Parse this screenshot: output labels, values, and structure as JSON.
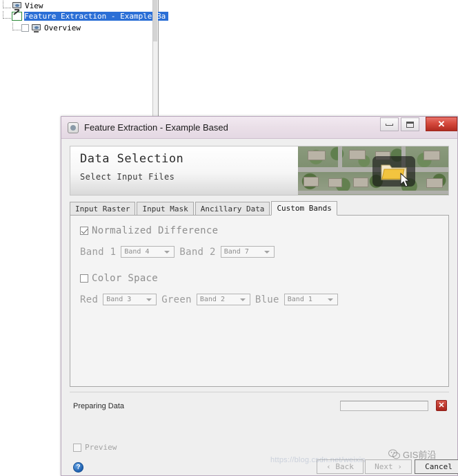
{
  "tree": {
    "items": [
      {
        "label": "View",
        "icon": "monitor-icon",
        "selected": false
      },
      {
        "label": "Feature Extraction - Example Ba",
        "icon": "pencil-icon",
        "selected": true
      },
      {
        "label": "Overview",
        "icon": "monitor-icon",
        "selected": false
      }
    ]
  },
  "dialog": {
    "title": "Feature Extraction - Example Based",
    "window_controls": {
      "minimize": "–",
      "maximize": "□",
      "close": "✕"
    },
    "banner": {
      "title": "Data Selection",
      "subtitle": "Select Input Files",
      "icon": "folder-icon",
      "cursor": "arrow-cursor"
    },
    "tabs": [
      {
        "label": "Input Raster",
        "active": false
      },
      {
        "label": "Input Mask",
        "active": false
      },
      {
        "label": "Ancillary Data",
        "active": false
      },
      {
        "label": "Custom Bands",
        "active": true
      }
    ],
    "normalized_difference": {
      "label": "Normalized Difference",
      "checked": true,
      "fields": [
        {
          "label": "Band 1",
          "value": "Band 4"
        },
        {
          "label": "Band 2",
          "value": "Band 7"
        }
      ]
    },
    "color_space": {
      "label": "Color Space",
      "checked": false,
      "fields": [
        {
          "label": "Red",
          "value": "Band 3"
        },
        {
          "label": "Green",
          "value": "Band 2"
        },
        {
          "label": "Blue",
          "value": "Band 1"
        }
      ]
    },
    "status": {
      "text": "Preparing Data",
      "progress_percent": 0,
      "cancel_label": "✕"
    },
    "preview": {
      "label": "Preview",
      "checked": false
    },
    "footer": {
      "help_label": "?",
      "back_label": "‹ Back",
      "next_label": "Next ›",
      "cancel_label": "Cancel"
    }
  },
  "watermark": {
    "url": "https://blog.csdn.net/weixin",
    "brand": "GIS前沿"
  },
  "colors": {
    "selection_blue": "#2b6fd6",
    "close_red": "#b02a20",
    "title_bar": "#eadfe8",
    "panel_bg": "#f4f4f4",
    "disabled_text": "#9c9c9c"
  }
}
